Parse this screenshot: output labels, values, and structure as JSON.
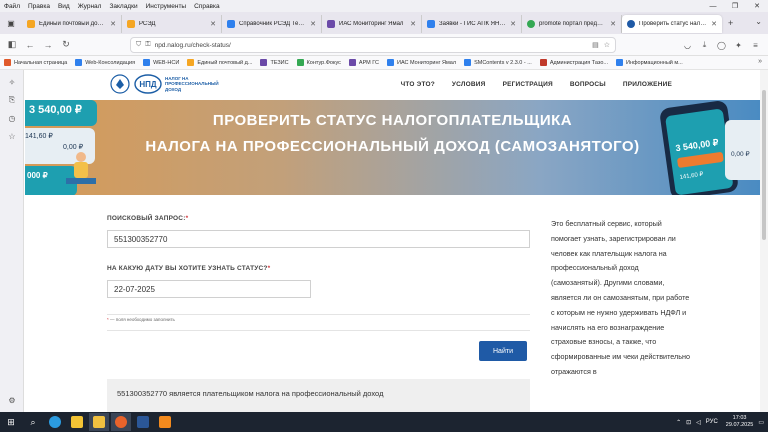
{
  "menubar": {
    "items": [
      "Файл",
      "Правка",
      "Вид",
      "Журнал",
      "Закладки",
      "Инструменты",
      "Справка"
    ]
  },
  "tabs": [
    {
      "label": "Единый почтовый домен",
      "color": "#f5a623",
      "active": false
    },
    {
      "label": "РСЭД",
      "color": "#f5a623",
      "active": false
    },
    {
      "label": "Справочник РСЭД Тезис",
      "color": "#2f80ed",
      "active": false
    },
    {
      "label": "ИАС Мониторинг Ямал",
      "color": "#6b4aa8",
      "active": false
    },
    {
      "label": "Заявки - ГИС АПК ЯНАО",
      "color": "#2f80ed",
      "active": false
    },
    {
      "label": "promote портал предоста",
      "color": "#34a853",
      "active": false
    },
    {
      "label": "Проверить статус налогоп",
      "color": "#1f5aa6",
      "active": true
    }
  ],
  "address": {
    "url": "npd.nalog.ru/check-status/"
  },
  "bookmarks": [
    {
      "label": "Начальная страница",
      "color": "#e05a2b"
    },
    {
      "label": "Web-Консолидация",
      "color": "#2f80ed"
    },
    {
      "label": "WEB-НСИ",
      "color": "#2f80ed"
    },
    {
      "label": "Единый почтовый д...",
      "color": "#f5a623"
    },
    {
      "label": "ТЕЗИС",
      "color": "#6b4aa8"
    },
    {
      "label": "Контур.Фокус",
      "color": "#34a853"
    },
    {
      "label": "АРМ ГС",
      "color": "#6b4aa8"
    },
    {
      "label": "ИАС Мониторинг Ямал",
      "color": "#2f80ed"
    },
    {
      "label": "SMContents v 2.3.0 - ...",
      "color": "#2f80ed"
    },
    {
      "label": "Администрация Тазо...",
      "color": "#c0392b"
    },
    {
      "label": "Информационный м...",
      "color": "#2f80ed"
    }
  ],
  "site": {
    "logo_text": "НАЛОГ НА ПРОФЕССИОНАЛЬНЫЙ ДОХОД",
    "badge": "НПД",
    "menu": [
      "ЧТО ЭТО?",
      "УСЛОВИЯ",
      "РЕГИСТРАЦИЯ",
      "ВОПРОСЫ",
      "ПРИЛОЖЕНИЕ"
    ],
    "hero_line1": "ПРОВЕРИТЬ СТАТУС НАЛОГОПЛАТЕЛЬЩИКА",
    "hero_line2": "НАЛОГА НА ПРОФЕССИОНАЛЬНЫЙ ДОХОД (САМОЗАНЯТОГО)",
    "hero_amounts": {
      "left_big": "3 540,00 ₽",
      "left_small": "141,60 ₽",
      "left_zero": "0,00 ₽",
      "left_bottom": "000 ₽",
      "right_big": "3 540,00 ₽",
      "right_small": "141,60 ₽",
      "right_zero": "0,00 ₽"
    }
  },
  "form": {
    "query_label": "ПОИСКОВЫЙ ЗАПРОС:",
    "query_value": "551300352770",
    "date_label": "НА КАКУЮ ДАТУ ВЫ ХОТИТЕ УЗНАТЬ СТАТУС?",
    "date_value": "22-07-2025",
    "required_mark": "*",
    "required_note": "— поля необходимо заполнить",
    "submit_label": "Найти"
  },
  "result": {
    "text": "551300352770 является плательщиком налога на профессиональный доход"
  },
  "info_text": "Это бесплатный сервис, который помогает узнать, зарегистрирован ли человек как плательщик налога на профессиональный доход (самозанятый). Другими словами, является ли он самозанятым, при работе с которым не нужно удерживать НДФЛ и начислять на его вознаграждение страховые взносы, а также, что сформированные им чеки действительно отражаются в",
  "taskbar": {
    "lang": "РУС",
    "time": "17:03",
    "date": "29.07.2025"
  }
}
